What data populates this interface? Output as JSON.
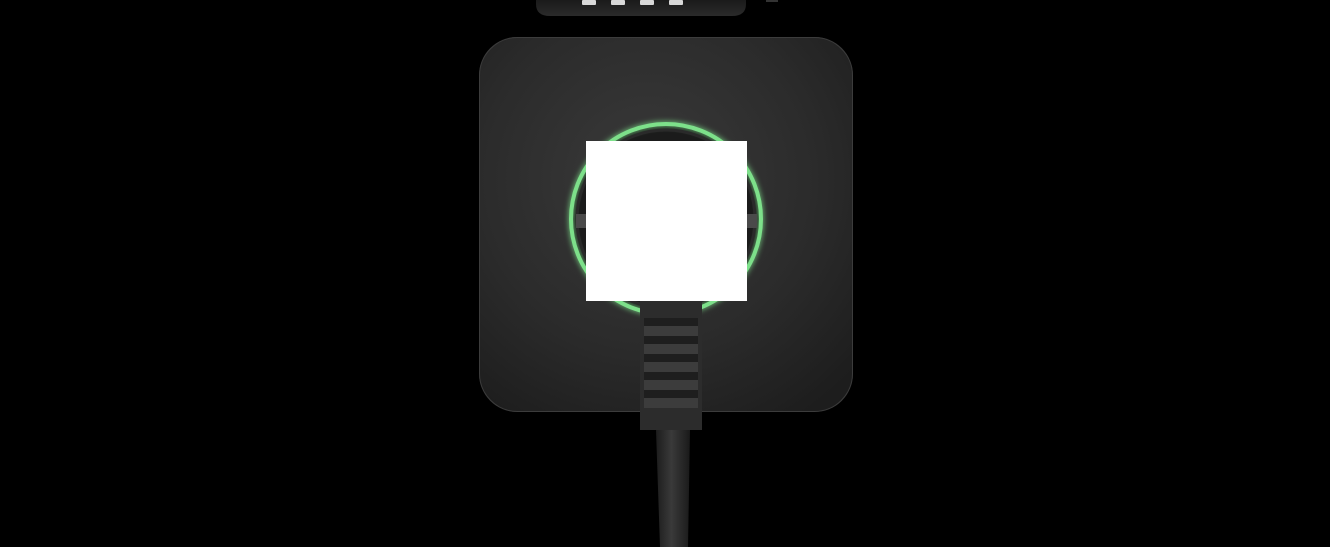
{
  "scene": {
    "subject": "smart-plug-icon",
    "ring_color": "#7de08a",
    "housing_color": "#2a2a2a",
    "background_color": "#000000",
    "cover_color": "#ffffff"
  }
}
